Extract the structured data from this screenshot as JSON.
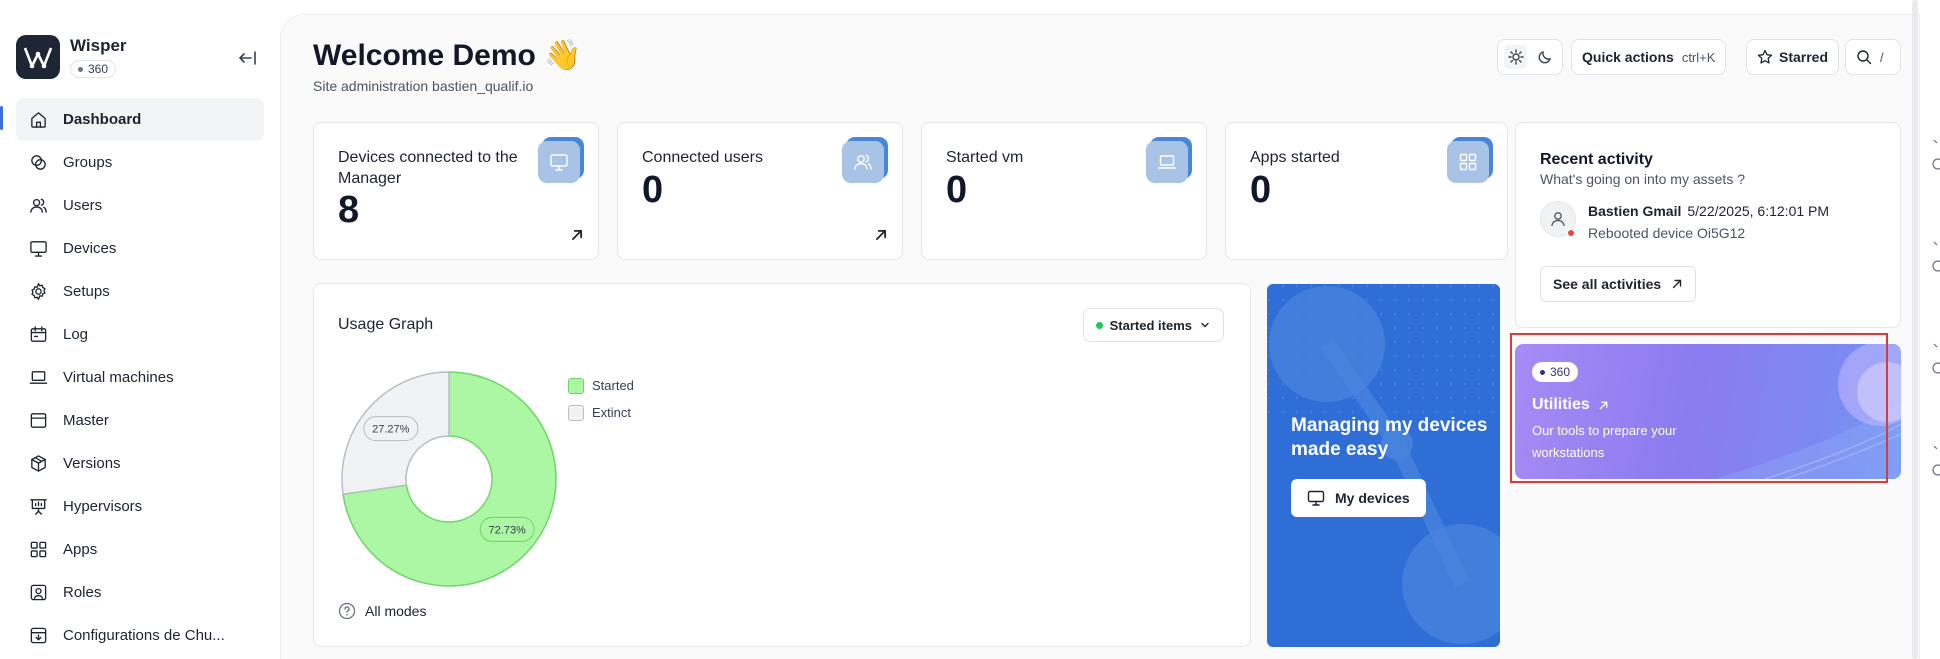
{
  "app": {
    "name": "Wisper",
    "badge": "360"
  },
  "sidebar": {
    "items": [
      {
        "label": "Dashboard",
        "icon": "home-icon",
        "active": true
      },
      {
        "label": "Groups",
        "icon": "groups-icon"
      },
      {
        "label": "Users",
        "icon": "users-icon"
      },
      {
        "label": "Devices",
        "icon": "monitor-icon"
      },
      {
        "label": "Setups",
        "icon": "gear-icon"
      },
      {
        "label": "Log",
        "icon": "calendar-icon"
      },
      {
        "label": "Virtual machines",
        "icon": "laptop-icon"
      },
      {
        "label": "Master",
        "icon": "window-icon"
      },
      {
        "label": "Versions",
        "icon": "package-icon"
      },
      {
        "label": "Hypervisors",
        "icon": "presentation-icon"
      },
      {
        "label": "Apps",
        "icon": "grid-icon"
      },
      {
        "label": "Roles",
        "icon": "badge-icon"
      },
      {
        "label": "Configurations de Chu...",
        "icon": "download-box-icon"
      }
    ]
  },
  "header": {
    "title": "Welcome Demo 👋",
    "subtitle": "Site administration bastien_qualif.io",
    "quick_actions": "Quick actions",
    "quick_actions_kbd": "ctrl+K",
    "starred": "Starred",
    "search_kbd": "/"
  },
  "stats": [
    {
      "label": "Devices connected to the Manager",
      "value": "8",
      "icon": "monitor-icon"
    },
    {
      "label": "Connected users",
      "value": "0",
      "icon": "users-icon"
    },
    {
      "label": "Started vm",
      "value": "0",
      "icon": "laptop-icon"
    },
    {
      "label": "Apps started",
      "value": "0",
      "icon": "grid-icon"
    }
  ],
  "usage": {
    "title": "Usage Graph",
    "filter": "Started items",
    "footer": "All modes"
  },
  "chart_data": {
    "type": "pie",
    "donut": true,
    "title": "Usage Graph",
    "series": [
      {
        "name": "Started",
        "value": 72.73,
        "label": "72.73%",
        "color": "#abf7a3",
        "stroke": "#6fd46a"
      },
      {
        "name": "Extinct",
        "value": 27.27,
        "label": "27.27%",
        "color": "#f1f2f4",
        "stroke": "#b9bdc4"
      }
    ],
    "legend": "right"
  },
  "promo": {
    "title": "Managing my devices made easy",
    "button": "My devices"
  },
  "recent": {
    "title": "Recent activity",
    "subtitle": "What's going on into my assets ?",
    "activity": {
      "user": "Bastien Gmail",
      "time": "5/22/2025, 6:12:01 PM",
      "action": "Rebooted device Oi5G12"
    },
    "see_all": "See all activities"
  },
  "utilities": {
    "badge": "360",
    "title": "Utilities",
    "description": "Our tools to prepare your workstations"
  }
}
